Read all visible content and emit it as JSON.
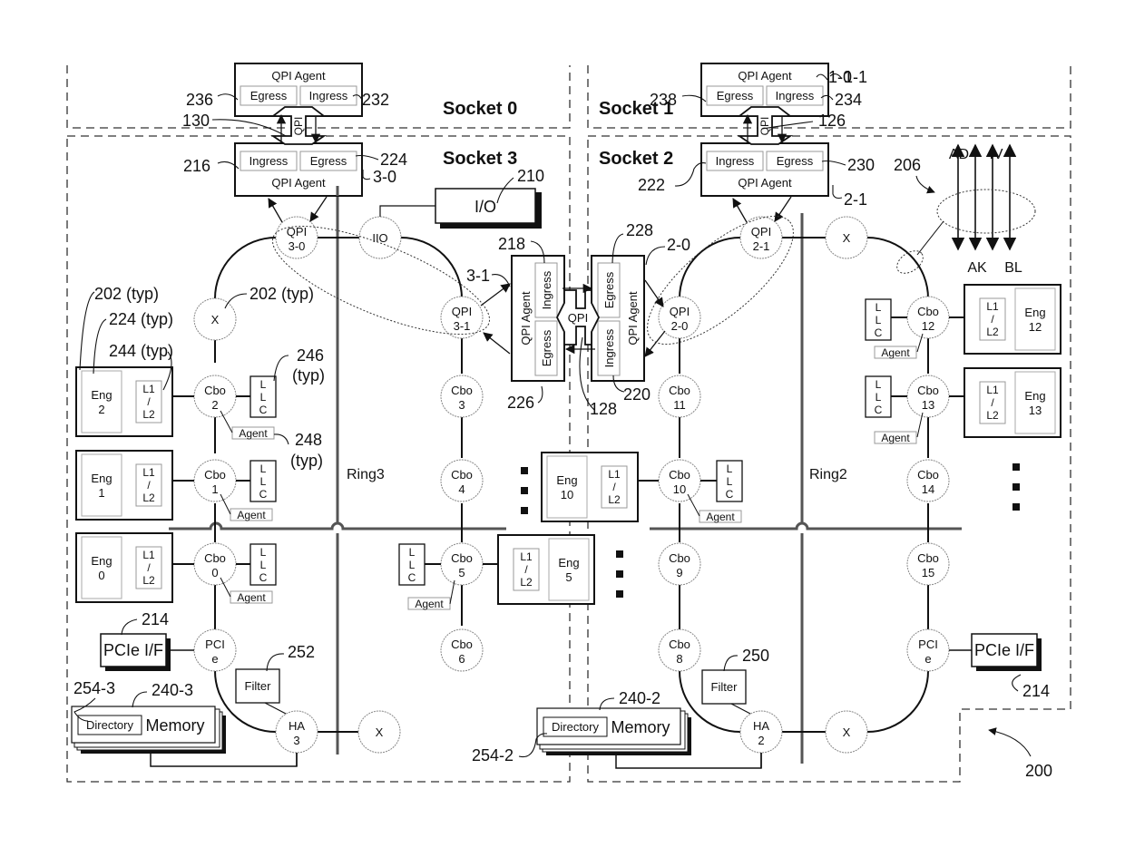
{
  "figure": {
    "figure_ref": "200",
    "sockets": [
      {
        "id": "socket-0",
        "label": "Socket 0"
      },
      {
        "id": "socket-1",
        "label": "Socket 1"
      },
      {
        "id": "socket-2",
        "label": "Socket 2"
      },
      {
        "id": "socket-3",
        "label": "Socket 3"
      }
    ],
    "rings": [
      {
        "id": "ring3",
        "label": "Ring3"
      },
      {
        "id": "ring2",
        "label": "Ring2"
      }
    ],
    "qpi_agents": [
      {
        "id": "1-0",
        "title": "QPI Agent",
        "left": "Egress",
        "right": "Ingress",
        "ref": "1-0",
        "left_ref": "236",
        "right_ref": "232"
      },
      {
        "id": "3-0",
        "title": "QPI Agent",
        "left": "Ingress",
        "right": "Egress",
        "ref": "3-0",
        "left_ref": "216",
        "right_ref": "224"
      },
      {
        "id": "1-1",
        "title": "QPI Agent",
        "left": "Egress",
        "right": "Ingress",
        "ref": "1-1",
        "left_ref": "238",
        "right_ref": "234"
      },
      {
        "id": "2-1",
        "title": "QPI Agent",
        "left": "Ingress",
        "right": "Egress",
        "ref": "2-1",
        "left_ref": "222",
        "right_ref": "230"
      },
      {
        "id": "3-1",
        "title": "QPI Agent",
        "top": "Ingress",
        "bottom": "Egress",
        "ref": "3-1",
        "top_ref": "218",
        "bottom_ref": "226"
      },
      {
        "id": "2-0",
        "title": "QPI Agent",
        "top": "Egress",
        "bottom": "Ingress",
        "ref": "2-0",
        "top_ref": "228",
        "bottom_ref": "220"
      }
    ],
    "qpi_links": [
      {
        "id": "link-130",
        "label": "QPI",
        "ref": "130"
      },
      {
        "id": "link-126",
        "label": "QPI",
        "ref": "126"
      },
      {
        "id": "link-128",
        "label": "QPI",
        "ref": "128"
      }
    ],
    "ring_nodes": {
      "qpi30": [
        "QPI",
        "3-0"
      ],
      "iio": [
        "IIO",
        ""
      ],
      "qpi31": [
        "QPI",
        "3-1"
      ],
      "x3": [
        "X",
        ""
      ],
      "cbo2": [
        "Cbo",
        "2"
      ],
      "cbo1": [
        "Cbo",
        "1"
      ],
      "cbo0": [
        "Cbo",
        "0"
      ],
      "pcie3": [
        "PCI",
        "e"
      ],
      "ha3": [
        "HA",
        "3"
      ],
      "x3b": [
        "X",
        ""
      ],
      "cbo3": [
        "Cbo",
        "3"
      ],
      "cbo4": [
        "Cbo",
        "4"
      ],
      "cbo5": [
        "Cbo",
        "5"
      ],
      "cbo6": [
        "Cbo",
        "6"
      ],
      "qpi21": [
        "QPI",
        "2-1"
      ],
      "x2": [
        "X",
        ""
      ],
      "qpi20": [
        "QPI",
        "2-0"
      ],
      "cbo11": [
        "Cbo",
        "11"
      ],
      "cbo10": [
        "Cbo",
        "10"
      ],
      "cbo9": [
        "Cbo",
        "9"
      ],
      "cbo8": [
        "Cbo",
        "8"
      ],
      "ha2": [
        "HA",
        "2"
      ],
      "x2b": [
        "X",
        ""
      ],
      "cbo12": [
        "Cbo",
        "12"
      ],
      "cbo13": [
        "Cbo",
        "13"
      ],
      "cbo14": [
        "Cbo",
        "14"
      ],
      "cbo15": [
        "Cbo",
        "15"
      ],
      "pcie2": [
        "PCI",
        "e"
      ]
    },
    "engines": [
      {
        "id": "eng2",
        "name": "Eng",
        "num": "2",
        "cache": [
          "L1",
          "/",
          "L2"
        ]
      },
      {
        "id": "eng1",
        "name": "Eng",
        "num": "1",
        "cache": [
          "L1",
          "/",
          "L2"
        ]
      },
      {
        "id": "eng0",
        "name": "Eng",
        "num": "0",
        "cache": [
          "L1",
          "/",
          "L2"
        ]
      },
      {
        "id": "eng5",
        "name": "Eng",
        "num": "5",
        "cache": [
          "L1",
          "/",
          "L2"
        ]
      },
      {
        "id": "eng10",
        "name": "Eng",
        "num": "10",
        "cache": [
          "L1",
          "/",
          "L2"
        ]
      },
      {
        "id": "eng12",
        "name": "Eng",
        "num": "12",
        "cache": [
          "L1",
          "/",
          "L2"
        ]
      },
      {
        "id": "eng13",
        "name": "Eng",
        "num": "13",
        "cache": [
          "L1",
          "/",
          "L2"
        ]
      }
    ],
    "llc_label": [
      "L",
      "L",
      "C"
    ],
    "agent_label": "Agent",
    "io": {
      "label": "I/O",
      "ref": "210"
    },
    "pcie_if": [
      {
        "id": "pcie-if-3",
        "label": "PCIe I/F",
        "ref": "214"
      },
      {
        "id": "pcie-if-2",
        "label": "PCIe I/F",
        "ref": "214"
      }
    ],
    "filters": [
      {
        "id": "filter-3",
        "label": "Filter",
        "ref": "252"
      },
      {
        "id": "filter-2",
        "label": "Filter",
        "ref": "250"
      }
    ],
    "memories": [
      {
        "id": "memory-3",
        "label": "Memory",
        "dir_label": "Directory",
        "ref": "240-3",
        "dir_ref": "254-3"
      },
      {
        "id": "memory-2",
        "label": "Memory",
        "dir_label": "Directory",
        "ref": "240-2",
        "dir_ref": "254-2"
      }
    ],
    "callouts": {
      "typ202a": "202 (typ)",
      "typ224": "224 (typ)",
      "typ244": "244 (typ)",
      "typ202b": "202 (typ)",
      "typ246a": "246",
      "typ246b": "(typ)",
      "typ248a": "248",
      "typ248b": "(typ)",
      "ref206": "206"
    },
    "ring_channels": {
      "ref": "206",
      "top": [
        "AD",
        "IV"
      ],
      "bottom": [
        "AK",
        "BL"
      ]
    },
    "ellipsis": "■"
  }
}
